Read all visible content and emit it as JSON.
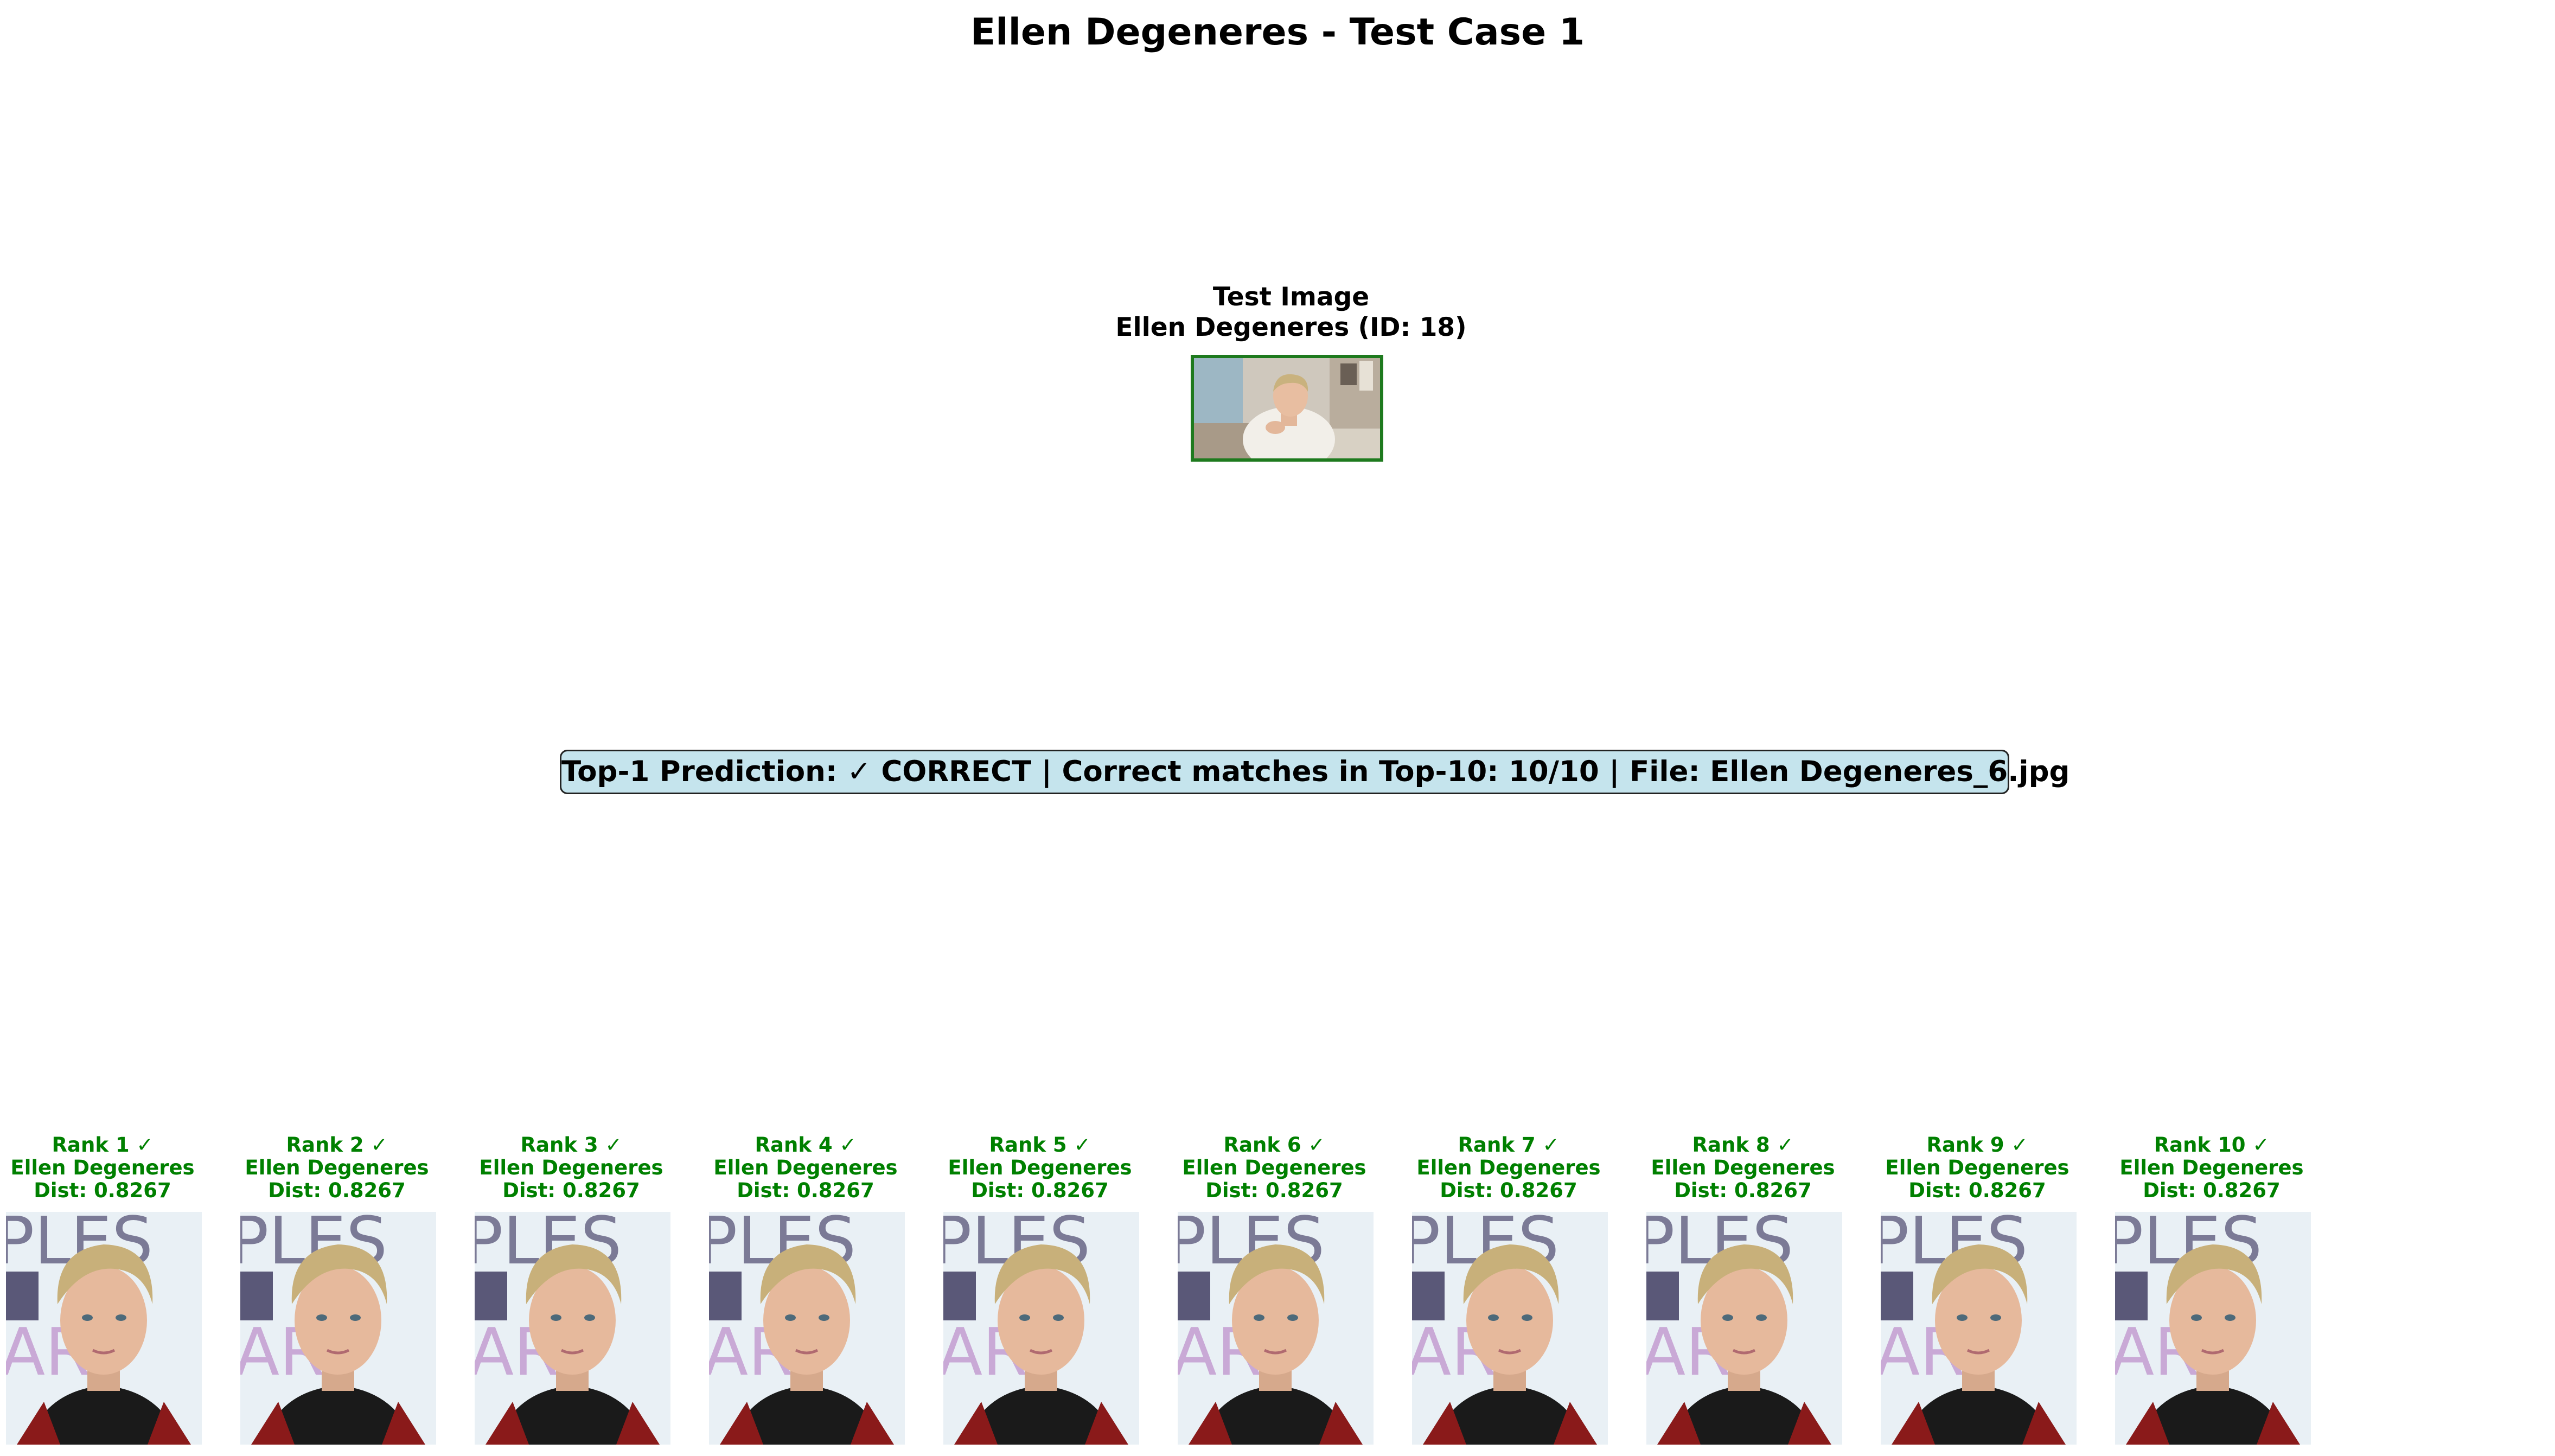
{
  "figure": {
    "title": "Ellen Degeneres - Test Case 1"
  },
  "test": {
    "title_line1": "Test Image",
    "title_line2": "Ellen Degeneres (ID: 18)",
    "border_color": "#1e7a1e"
  },
  "summary": {
    "text": "Top-1 Prediction: ✓ CORRECT | Correct matches in Top-10: 10/10 | File: Ellen Degeneres_6.jpg",
    "box_color": "#add8e6"
  },
  "matches": [
    {
      "rank": "Rank 1 ✓",
      "name": "Ellen Degeneres",
      "dist": "Dist: 0.8267"
    },
    {
      "rank": "Rank 2 ✓",
      "name": "Ellen Degeneres",
      "dist": "Dist: 0.8267"
    },
    {
      "rank": "Rank 3 ✓",
      "name": "Ellen Degeneres",
      "dist": "Dist: 0.8267"
    },
    {
      "rank": "Rank 4 ✓",
      "name": "Ellen Degeneres",
      "dist": "Dist: 0.8267"
    },
    {
      "rank": "Rank 5 ✓",
      "name": "Ellen Degeneres",
      "dist": "Dist: 0.8267"
    },
    {
      "rank": "Rank 6 ✓",
      "name": "Ellen Degeneres",
      "dist": "Dist: 0.8267"
    },
    {
      "rank": "Rank 7 ✓",
      "name": "Ellen Degeneres",
      "dist": "Dist: 0.8267"
    },
    {
      "rank": "Rank 8 ✓",
      "name": "Ellen Degeneres",
      "dist": "Dist: 0.8267"
    },
    {
      "rank": "Rank 9 ✓",
      "name": "Ellen Degeneres",
      "dist": "Dist: 0.8267"
    },
    {
      "rank": "Rank 10 ✓",
      "name": "Ellen Degeneres",
      "dist": "Dist: 0.8267"
    }
  ],
  "match_label_color": "#008000"
}
